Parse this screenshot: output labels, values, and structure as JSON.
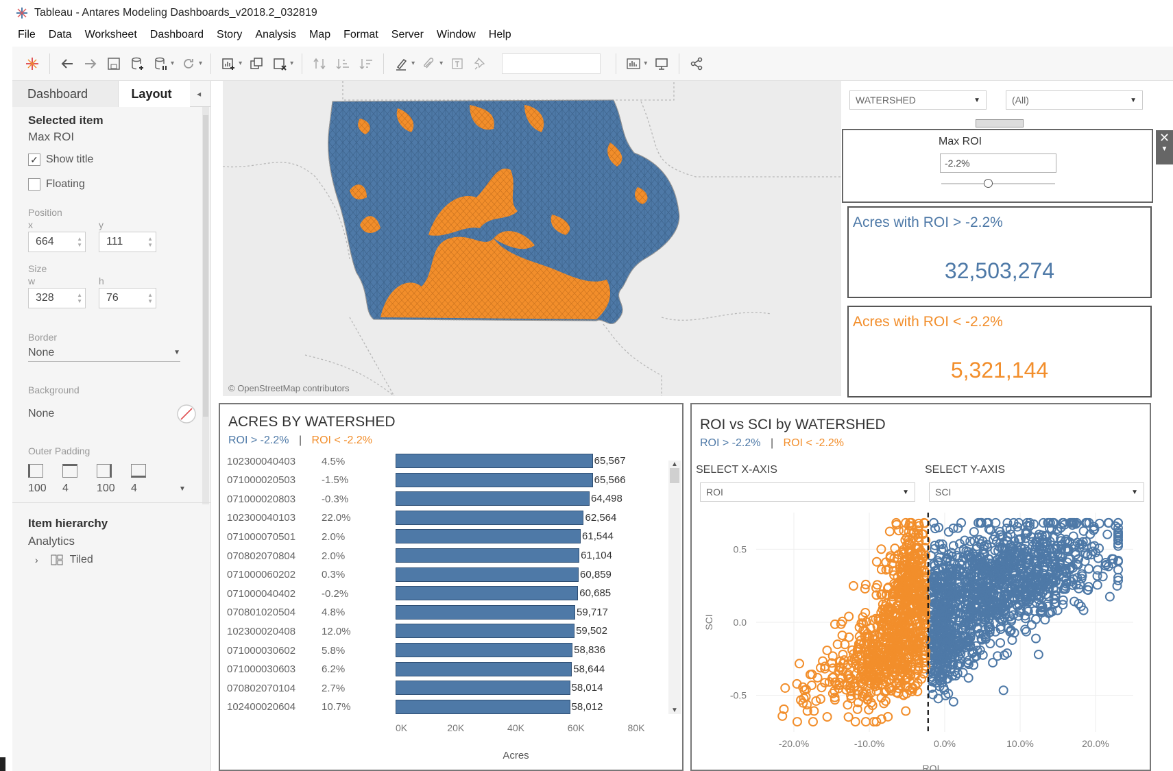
{
  "window": {
    "title": "Tableau - Antares Modeling Dashboards_v2018.2_032819"
  },
  "menu": [
    "File",
    "Data",
    "Worksheet",
    "Dashboard",
    "Story",
    "Analysis",
    "Map",
    "Format",
    "Server",
    "Window",
    "Help"
  ],
  "toolbar": {
    "icons": [
      "tableau-logo-icon",
      "back-icon",
      "forward-icon",
      "save-icon",
      "add-datasource-icon",
      "pause-update-icon",
      "refresh-icon",
      "new-worksheet-icon",
      "duplicate-sheet-icon",
      "clear-sheet-icon",
      "swap-icon",
      "sort-asc-icon",
      "sort-desc-icon",
      "highlight-icon",
      "group-icon",
      "label-icon",
      "pin-icon",
      "show-me-icon",
      "presentation-icon",
      "share-icon"
    ]
  },
  "left_panel": {
    "tabs": {
      "dashboard": "Dashboard",
      "layout": "Layout",
      "more": "◂"
    },
    "selected_item": {
      "heading": "Selected item",
      "value": "Max ROI"
    },
    "show_title": {
      "label": "Show title",
      "checked": true
    },
    "floating": {
      "label": "Floating",
      "checked": false
    },
    "position": {
      "label": "Position",
      "x_label": "x",
      "y_label": "y",
      "x": "664",
      "y": "111"
    },
    "size": {
      "label": "Size",
      "w_label": "w",
      "h_label": "h",
      "w": "328",
      "h": "76"
    },
    "border": {
      "label": "Border",
      "value": "None"
    },
    "background": {
      "label": "Background",
      "value": "None"
    },
    "outer_padding": {
      "label": "Outer Padding",
      "values": [
        "100",
        "4",
        "100",
        "4"
      ]
    },
    "hierarchy": {
      "heading": "Item hierarchy",
      "value": "Analytics",
      "child": "Tiled"
    }
  },
  "map": {
    "credit": "© OpenStreetMap contributors"
  },
  "filters": {
    "level": "WATERSHED",
    "filter": "(All)"
  },
  "parameter": {
    "title": "Max ROI",
    "value": "-2.2%"
  },
  "kpi_above": {
    "title": "Acres with ROI > -2.2%",
    "value": "32,503,274"
  },
  "kpi_below": {
    "title": "Acres with ROI < -2.2%",
    "value": "5,321,144"
  },
  "bar_panel": {
    "title": "ACRES BY WATERSHED",
    "legend_above": "ROI > -2.2%",
    "legend_sep": "|",
    "legend_below": "ROI < -2.2%",
    "x_axis_title": "Acres",
    "x_ticks": [
      "0K",
      "20K",
      "40K",
      "60K",
      "80K"
    ]
  },
  "scatter_panel": {
    "title": "ROI vs SCI by WATERSHED",
    "legend_above": "ROI > -2.2%",
    "legend_sep": "|",
    "legend_below": "ROI < -2.2%",
    "x_select_label": "SELECT X-AXIS",
    "y_select_label": "SELECT Y-AXIS",
    "x_select_value": "ROI",
    "y_select_value": "SCI",
    "x_axis_title": "ROI",
    "y_axis_title": "SCI",
    "x_ticks": [
      "-20.0%",
      "-10.0%",
      "0.0%",
      "10.0%",
      "20.0%"
    ],
    "y_ticks": [
      "0.5",
      "0.0",
      "-0.5"
    ]
  },
  "colors": {
    "above": "#4e79a7",
    "below": "#f28e2b"
  },
  "chart_data": [
    {
      "type": "bar",
      "title": "ACRES BY WATERSHED",
      "xlabel": "Acres",
      "xlim": [
        0,
        80000
      ],
      "categories": [
        "102300040403",
        "071000020503",
        "071000020803",
        "102300040103",
        "071000070501",
        "070802070804",
        "071000060202",
        "071000040402",
        "070801020504",
        "102300020408",
        "071000030602",
        "071000030603",
        "070802070104",
        "102400020604"
      ],
      "roi": [
        "4.5%",
        "-1.5%",
        "-0.3%",
        "22.0%",
        "2.0%",
        "2.0%",
        "0.3%",
        "-0.2%",
        "4.8%",
        "12.0%",
        "5.8%",
        "6.2%",
        "2.7%",
        "10.7%"
      ],
      "values": [
        65567,
        65566,
        64498,
        62564,
        61544,
        61104,
        60859,
        60685,
        59717,
        59502,
        58836,
        58644,
        58014,
        58012
      ],
      "value_labels": [
        "65,567",
        "65,566",
        "64,498",
        "62,564",
        "61,544",
        "61,104",
        "60,859",
        "60,685",
        "59,717",
        "59,502",
        "58,836",
        "58,644",
        "58,014",
        "58,012"
      ]
    },
    {
      "type": "scatter",
      "title": "ROI vs SCI by WATERSHED",
      "xlabel": "ROI",
      "ylabel": "SCI",
      "xlim": [
        -25,
        25
      ],
      "ylim": [
        -0.75,
        0.75
      ],
      "threshold_x": -2.2,
      "series": [
        {
          "name": "ROI > -2.2%",
          "clusters": [
            {
              "cx": 5,
              "cy": 0.25,
              "sx": 6,
              "sy": 0.2,
              "n": 900
            },
            {
              "cx": 14,
              "cy": 0.4,
              "sx": 5,
              "sy": 0.15,
              "n": 250
            },
            {
              "cx": 0,
              "cy": -0.2,
              "sx": 2.5,
              "sy": 0.15,
              "n": 200
            }
          ]
        },
        {
          "name": "ROI < -2.2%",
          "clusters": [
            {
              "cx": -7,
              "cy": -0.2,
              "sx": 3.5,
              "sy": 0.18,
              "n": 550
            },
            {
              "cx": -4.5,
              "cy": 0.3,
              "sx": 1.8,
              "sy": 0.18,
              "n": 250
            },
            {
              "cx": -15,
              "cy": -0.4,
              "sx": 4,
              "sy": 0.12,
              "n": 60
            }
          ]
        }
      ]
    }
  ]
}
